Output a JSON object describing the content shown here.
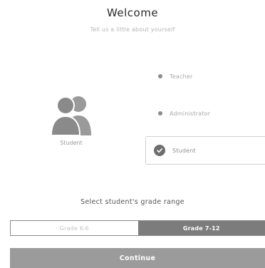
{
  "header": {
    "title": "Welcome",
    "subtitle": "Tell us a little about yourself"
  },
  "avatar": {
    "icon": "people-icon",
    "caption": "Student"
  },
  "roles": [
    {
      "label": "Teacher",
      "selected": false
    },
    {
      "label": "Administrator",
      "selected": false
    },
    {
      "label": "Student",
      "selected": true
    }
  ],
  "grade": {
    "prompt": "Select student's grade range",
    "options": [
      "Grade K-6",
      "Grade 7-12"
    ],
    "selected": "Grade 7-12"
  },
  "actions": {
    "continue_label": "Continue"
  },
  "colors": {
    "accent": "#7c7c7c",
    "button": "#9b9b9b"
  }
}
